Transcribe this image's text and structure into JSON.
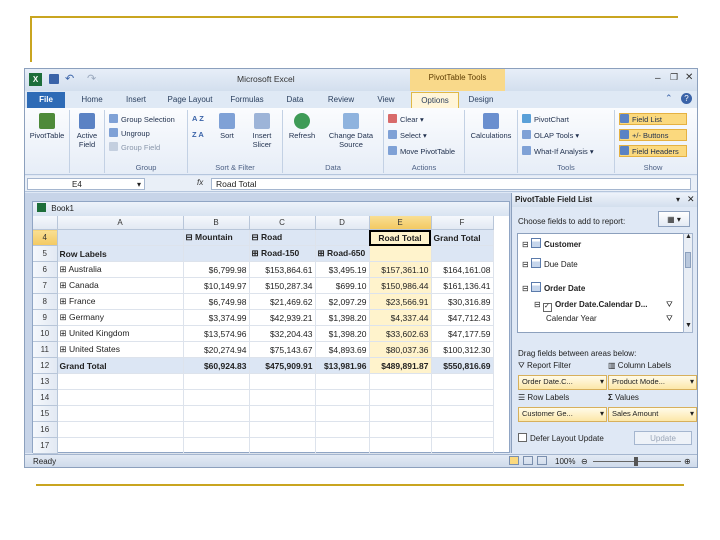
{
  "window": {
    "app_title": "Microsoft Excel",
    "contextual_tab_title": "PivotTable Tools",
    "qat": [
      "save-icon",
      "undo-icon",
      "redo-icon"
    ],
    "controls": [
      "minimize-icon",
      "restore-icon",
      "close-icon"
    ]
  },
  "tabs": [
    {
      "label": "File"
    },
    {
      "label": "Home"
    },
    {
      "label": "Insert"
    },
    {
      "label": "Page Layout"
    },
    {
      "label": "Formulas"
    },
    {
      "label": "Data"
    },
    {
      "label": "Review"
    },
    {
      "label": "View"
    },
    {
      "label": "Options"
    },
    {
      "label": "Design"
    }
  ],
  "ribbon": {
    "pivottable": "PivotTable",
    "active_field": "Active Field",
    "group_selection": "Group Selection",
    "ungroup": "Ungroup",
    "group_field": "Group Field",
    "group_label": "Group",
    "sort_az": "A Z",
    "sort_za": "Z A",
    "sort": "Sort",
    "insert_slicer": "Insert Slicer",
    "sort_filter_label": "Sort & Filter",
    "refresh": "Refresh",
    "change_data_source": "Change Data Source",
    "data_label": "Data",
    "clear": "Clear",
    "select": "Select",
    "move_pivottable": "Move PivotTable",
    "actions_label": "Actions",
    "calculations": "Calculations",
    "pivotchart": "PivotChart",
    "olap_tools": "OLAP Tools",
    "what_if": "What-If Analysis",
    "tools_label": "Tools",
    "field_list": "Field List",
    "buttons": "+/- Buttons",
    "field_headers": "Field Headers",
    "show_label": "Show"
  },
  "formula_bar": {
    "name_box": "E4",
    "fx": "fx",
    "content": "Road Total"
  },
  "workbook": {
    "title": "Book1"
  },
  "grid": {
    "columns": [
      "A",
      "B",
      "C",
      "D",
      "E",
      "F"
    ],
    "rows": [
      {
        "n": "4",
        "cells": [
          "",
          "⊟ Mountain",
          "⊟ Road",
          "",
          "Road Total",
          "Grand Total"
        ]
      },
      {
        "n": "5",
        "cells": [
          "Row Labels",
          "",
          "⊞ Road-150",
          "⊞ Road-650",
          "",
          ""
        ]
      },
      {
        "n": "6",
        "cells": [
          "⊞ Australia",
          "$6,799.98",
          "$153,864.61",
          "$3,495.19",
          "$157,361.10",
          "$164,161.08"
        ]
      },
      {
        "n": "7",
        "cells": [
          "⊞ Canada",
          "$10,149.97",
          "$150,287.34",
          "$699.10",
          "$150,986.44",
          "$161,136.41"
        ]
      },
      {
        "n": "8",
        "cells": [
          "⊞ France",
          "$6,749.98",
          "$21,469.62",
          "$2,097.29",
          "$23,566.91",
          "$30,316.89"
        ]
      },
      {
        "n": "9",
        "cells": [
          "⊞ Germany",
          "$3,374.99",
          "$42,939.21",
          "$1,398.20",
          "$4,337.44",
          "$47,712.43"
        ]
      },
      {
        "n": "10",
        "cells": [
          "⊞ United Kingdom",
          "$13,574.96",
          "$32,204.43",
          "$1,398.20",
          "$33,602.63",
          "$47,177.59"
        ]
      },
      {
        "n": "11",
        "cells": [
          "⊞ United States",
          "$20,274.94",
          "$75,143.67",
          "$4,893.69",
          "$80,037.36",
          "$100,312.30"
        ]
      },
      {
        "n": "12",
        "cells": [
          "Grand Total",
          "$60,924.83",
          "$475,909.91",
          "$13,981.96",
          "$489,891.87",
          "$550,816.69"
        ]
      },
      {
        "n": "13",
        "cells": [
          "",
          "",
          "",
          "",
          "",
          ""
        ]
      },
      {
        "n": "14",
        "cells": [
          "",
          "",
          "",
          "",
          "",
          ""
        ]
      },
      {
        "n": "15",
        "cells": [
          "",
          "",
          "",
          "",
          "",
          ""
        ]
      },
      {
        "n": "16",
        "cells": [
          "",
          "",
          "",
          "",
          "",
          ""
        ]
      },
      {
        "n": "17",
        "cells": [
          "",
          "",
          "",
          "",
          "",
          ""
        ]
      }
    ]
  },
  "field_list": {
    "title": "PivotTable Field List",
    "choose_label": "Choose fields to add to report:",
    "fields": [
      {
        "label": "Customer",
        "kind": "table",
        "bold": true
      },
      {
        "label": "Due Date",
        "kind": "table",
        "bold": false
      },
      {
        "label": "Order Date",
        "kind": "table",
        "bold": true
      },
      {
        "label": "Order Date.Calendar D...",
        "kind": "check",
        "bold": true
      },
      {
        "label": "Calendar Year",
        "kind": "plain",
        "bold": false
      }
    ],
    "drag_label": "Drag fields between areas below:",
    "report_filter": "Report Filter",
    "column_labels": "Column Labels",
    "row_labels": "Row Labels",
    "values": "Values",
    "filter_chip": "Order Date.C...",
    "column_chip": "Product Mode...",
    "row_chip": "Customer Ge...",
    "value_chip": "Sales Amount",
    "defer_label": "Defer Layout Update",
    "update_button": "Update"
  },
  "status": {
    "ready": "Ready",
    "zoom": "100%"
  }
}
